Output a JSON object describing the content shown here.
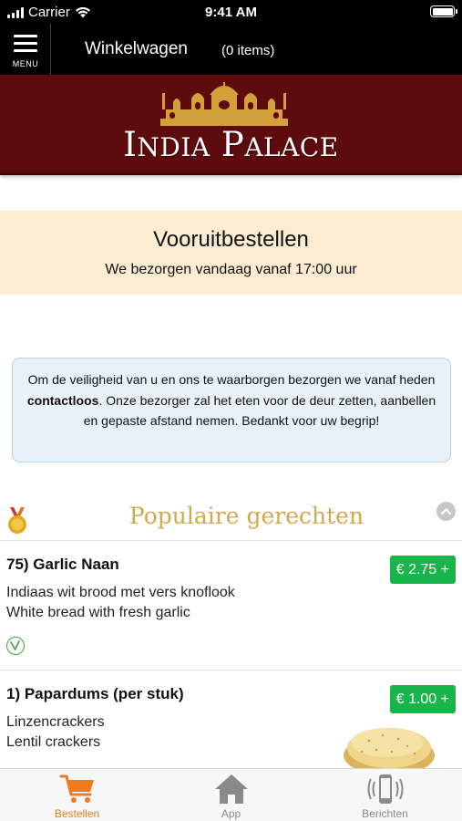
{
  "status_bar": {
    "carrier": "Carrier",
    "time": "9:41 AM"
  },
  "nav": {
    "menu_label": "MENU",
    "title": "Winkelwagen",
    "item_count": "(0 items)"
  },
  "banner": {
    "logo_text_first_initial": "I",
    "logo_text_first_rest": "NDIA",
    "logo_text_second_initial": "P",
    "logo_text_second_rest": "ALACE"
  },
  "preorder": {
    "title": "Vooruitbestellen",
    "subtitle": "We bezorgen vandaag vanaf 17:00 uur"
  },
  "notice": {
    "text_before": "Om de veiligheid van u en ons te waarborgen bezorgen we vanaf heden ",
    "text_bold": "contactloos",
    "text_after": ". Onze bezorger zal het eten voor de deur zetten, aanbellen en gepaste afstand nemen. Bedankt voor uw begrip!"
  },
  "popular": {
    "title": "Populaire gerechten"
  },
  "dishes": [
    {
      "title": "75)  Garlic Naan",
      "line1": "Indiaas wit brood met vers knoflook",
      "line2": "White bread with fresh garlic",
      "price": "€ 2.75 +",
      "vegetarian": true
    },
    {
      "title": "1)  Papardums (per stuk)",
      "line1": "Linzencrackers",
      "line2": "Lentil crackers",
      "price": "€ 1.00 +",
      "image": "papadum-photo"
    }
  ],
  "tabs": [
    {
      "label": "Bestellen",
      "icon": "cart-icon",
      "active": true
    },
    {
      "label": "App",
      "icon": "home-icon",
      "active": false
    },
    {
      "label": "Berichten",
      "icon": "phone-vibrate-icon",
      "active": false
    }
  ],
  "colors": {
    "banner_bg": "#5e0b0e",
    "preorder_bg": "#fdecd2",
    "notice_bg": "#e8f1f8",
    "price_green": "#18b64a",
    "popular_gold": "#d4a84a",
    "active_tab": "#f07a1c"
  }
}
